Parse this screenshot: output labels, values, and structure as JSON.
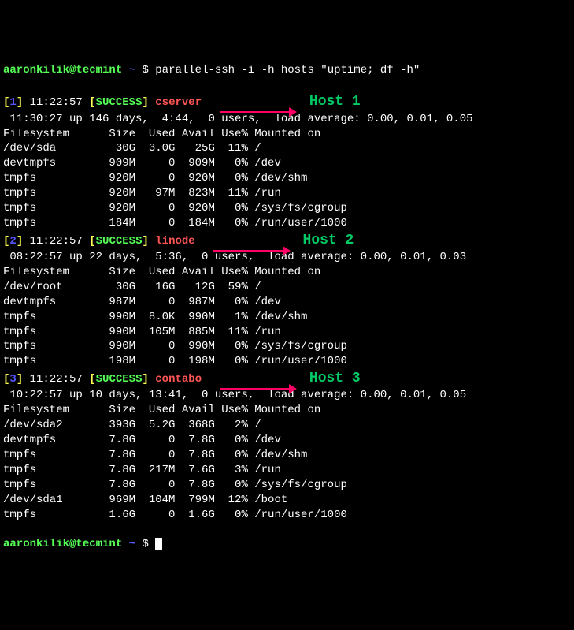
{
  "prompt": {
    "user": "aaronkilik@tecmint",
    "tilde": "~",
    "dollar": "$",
    "command": "parallel-ssh -i -h hosts \"uptime; df -h\""
  },
  "results": [
    {
      "idx": "1",
      "time": "11:22:57",
      "status": "SUCCESS",
      "hostname": "cserver",
      "annotation": "Host 1",
      "uptime": " 11:30:27 up 146 days,  4:44,  0 users,  load average: 0.00, 0.01, 0.05",
      "df_header": "Filesystem      Size  Used Avail Use% Mounted on",
      "df": [
        "/dev/sda         30G  3.0G   25G  11% /",
        "devtmpfs        909M     0  909M   0% /dev",
        "tmpfs           920M     0  920M   0% /dev/shm",
        "tmpfs           920M   97M  823M  11% /run",
        "tmpfs           920M     0  920M   0% /sys/fs/cgroup",
        "tmpfs           184M     0  184M   0% /run/user/1000"
      ]
    },
    {
      "idx": "2",
      "time": "11:22:57",
      "status": "SUCCESS",
      "hostname": "linode",
      "annotation": "Host 2",
      "uptime": " 08:22:57 up 22 days,  5:36,  0 users,  load average: 0.00, 0.01, 0.03",
      "df_header": "Filesystem      Size  Used Avail Use% Mounted on",
      "df": [
        "/dev/root        30G   16G   12G  59% /",
        "devtmpfs        987M     0  987M   0% /dev",
        "tmpfs           990M  8.0K  990M   1% /dev/shm",
        "tmpfs           990M  105M  885M  11% /run",
        "tmpfs           990M     0  990M   0% /sys/fs/cgroup",
        "tmpfs           198M     0  198M   0% /run/user/1000"
      ]
    },
    {
      "idx": "3",
      "time": "11:22:57",
      "status": "SUCCESS",
      "hostname": "contabo",
      "annotation": "Host 3",
      "uptime": " 10:22:57 up 10 days, 13:41,  0 users,  load average: 0.00, 0.01, 0.05",
      "df_header": "Filesystem      Size  Used Avail Use% Mounted on",
      "df": [
        "/dev/sda2       393G  5.2G  368G   2% /",
        "devtmpfs        7.8G     0  7.8G   0% /dev",
        "tmpfs           7.8G     0  7.8G   0% /dev/shm",
        "tmpfs           7.8G  217M  7.6G   3% /run",
        "tmpfs           7.8G     0  7.8G   0% /sys/fs/cgroup",
        "/dev/sda1       969M  104M  799M  12% /boot",
        "tmpfs           1.6G     0  1.6G   0% /run/user/1000"
      ]
    }
  ]
}
